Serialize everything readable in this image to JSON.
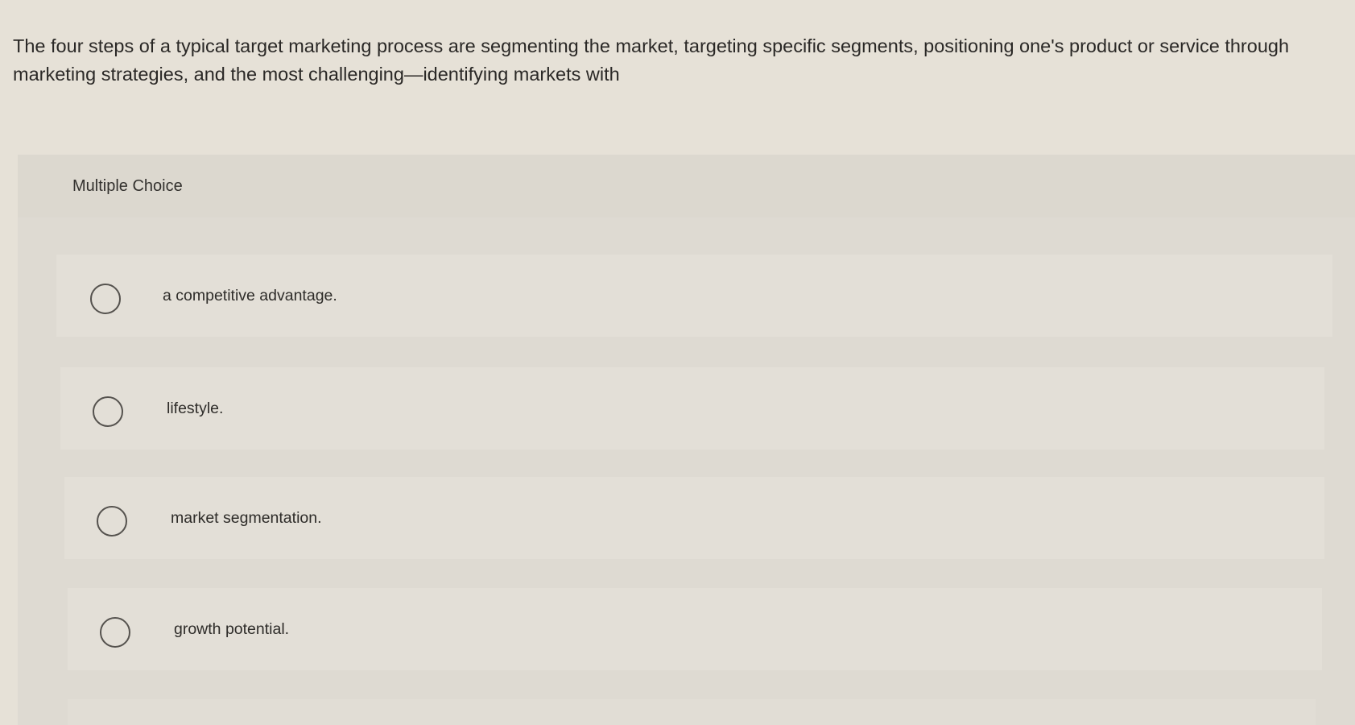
{
  "question": {
    "text": "The four steps of a typical target marketing process are segmenting the market, targeting specific segments, positioning one's product or service through marketing strategies, and the most challenging—identifying markets with"
  },
  "multiple_choice": {
    "label": "Multiple Choice",
    "options": [
      {
        "label": "a competitive advantage.",
        "selected": false
      },
      {
        "label": "lifestyle.",
        "selected": false
      },
      {
        "label": "market segmentation.",
        "selected": false
      },
      {
        "label": "growth potential.",
        "selected": false
      }
    ]
  }
}
